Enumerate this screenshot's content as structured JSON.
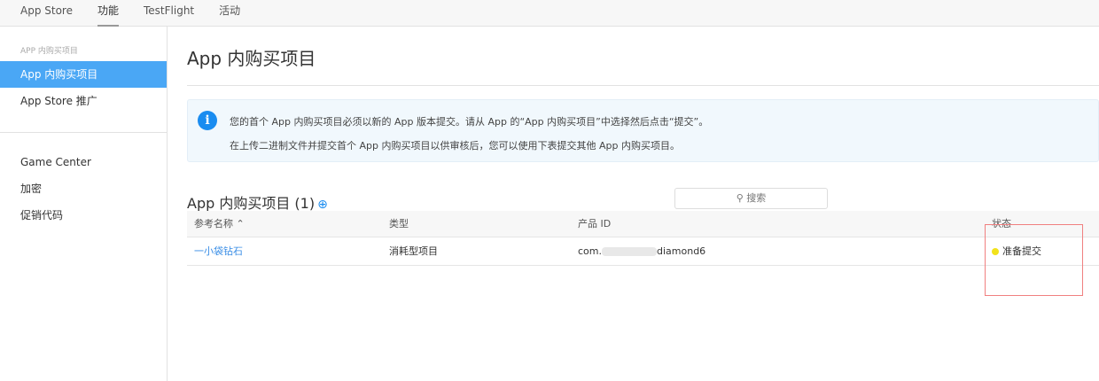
{
  "topnav": {
    "tabs": [
      {
        "label": "App Store"
      },
      {
        "label": "功能"
      },
      {
        "label": "TestFlight"
      },
      {
        "label": "活动"
      }
    ]
  },
  "sidebar": {
    "section_title": "APP 内购买项目",
    "items": [
      {
        "label": "App 内购买项目"
      },
      {
        "label": "App Store 推广"
      }
    ],
    "items2": [
      {
        "label": "Game Center"
      },
      {
        "label": "加密"
      },
      {
        "label": "促销代码"
      }
    ]
  },
  "main": {
    "title": "App 内购买项目",
    "info": {
      "icon": "info-icon",
      "line1": "您的首个 App 内购买项目必须以新的 App 版本提交。请从 App 的“App 内购买项目”中选择然后点击“提交”。",
      "line2": "在上传二进制文件并提交首个 App 内购买项目以供审核后，您可以使用下表提交其他 App 内购买项目。"
    },
    "section_title": "App 内购买项目 (1)",
    "add_icon": "⊕",
    "search_placeholder": "搜索",
    "columns": [
      "参考名称 ⌃",
      "类型",
      "产品 ID",
      "状态"
    ],
    "rows": [
      {
        "name": "一小袋钻石",
        "type": "消耗型项目",
        "id_prefix": "com.",
        "id_suffix": "diamond6",
        "status": "准备提交",
        "status_color": "#f2e21b"
      }
    ]
  }
}
